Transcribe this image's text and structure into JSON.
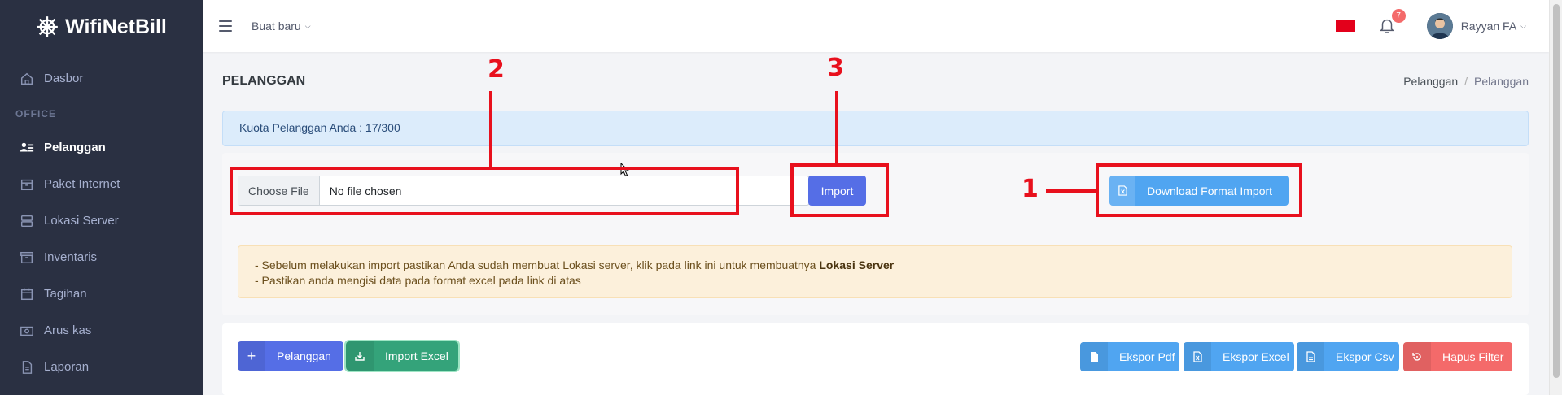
{
  "app": {
    "brand": "WifiNetBill"
  },
  "sidebar": {
    "items": [
      {
        "label": "Dasbor",
        "icon": "home-icon"
      },
      {
        "label": "Pelanggan",
        "icon": "users-list-icon"
      },
      {
        "label": "Paket Internet",
        "icon": "package-icon"
      },
      {
        "label": "Lokasi Server",
        "icon": "server-icon"
      },
      {
        "label": "Inventaris",
        "icon": "archive-icon"
      },
      {
        "label": "Tagihan",
        "icon": "calendar-icon"
      },
      {
        "label": "Arus kas",
        "icon": "cash-icon"
      },
      {
        "label": "Laporan",
        "icon": "document-icon"
      }
    ],
    "section_office": "OFFICE",
    "active": "Pelanggan"
  },
  "topbar": {
    "create_new": "Buat baru",
    "notification_count": "7",
    "user_name": "Rayyan FA",
    "flag_color": "#e3001b"
  },
  "page": {
    "title": "PELANGGAN",
    "breadcrumb": [
      "Pelanggan",
      "/",
      "Pelanggan"
    ]
  },
  "quota": {
    "text": "Kuota Pelanggan Anda : 17/300"
  },
  "import_form": {
    "choose_file_label": "Choose File",
    "file_status": "No file chosen",
    "import_button": "Import",
    "download_button": "Download Format Import"
  },
  "notice": {
    "line1_prefix": "- Sebelum melakukan import pastikan Anda sudah membuat Lokasi server, klik pada link ini untuk membuatnya",
    "line1_link": "Lokasi Server",
    "line2": "- Pastikan anda mengisi data pada format excel pada link di atas"
  },
  "actions": {
    "add_customer": "Pelanggan",
    "import_excel": "Import Excel",
    "export_pdf": "Ekspor Pdf",
    "export_excel": "Ekspor Excel",
    "export_csv": "Ekspor Csv",
    "clear_filter": "Hapus Filter"
  },
  "annotations": {
    "n1": "1",
    "n2": "2",
    "n3": "3"
  },
  "colors": {
    "sidebar_bg": "#2a3042",
    "primary": "#556ee6",
    "info": "#50a5f1",
    "success": "#34c38f",
    "danger": "#f46a6a",
    "annotation": "#e8101d"
  }
}
